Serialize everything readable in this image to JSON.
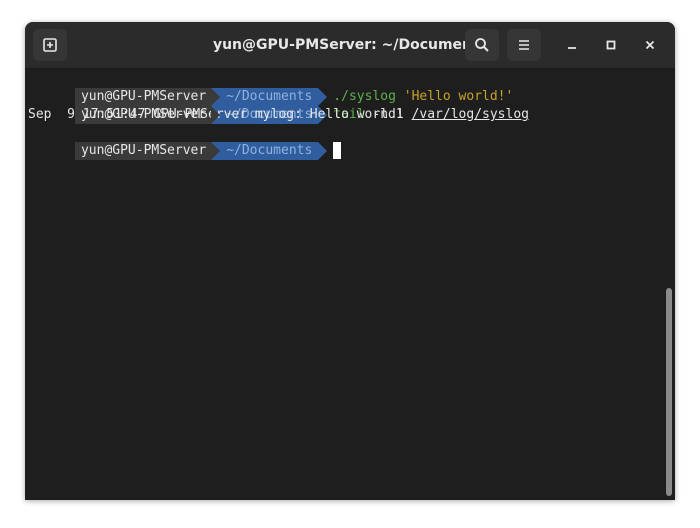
{
  "window": {
    "title": "yun@GPU-PMServer: ~/Documents"
  },
  "icons": {
    "new_tab": "new-tab-icon",
    "search": "search-icon",
    "menu": "hamburger-menu-icon",
    "minimize": "minimize-icon",
    "maximize": "maximize-icon",
    "close": "close-icon"
  },
  "colors": {
    "prompt_user_bg": "#3a3a3a",
    "prompt_dir_bg": "#2f5d9e",
    "command_green": "#5fb34a",
    "string_yellow": "#c9a227",
    "terminal_bg": "#1e1e1e"
  },
  "terminal": {
    "lines": [
      {
        "user": "yun@GPU-PMServer",
        "dir": "~/Documents",
        "command": "./syslog",
        "argument": "'Hello world!'"
      },
      {
        "user": "yun@GPU-PMServer",
        "dir": "~/Documents",
        "command": "tail",
        "options": "-n 1",
        "path": "/var/log/syslog"
      },
      {
        "output": "Sep  9 17:51:47 GPU-PMServer mylog: Hello world!"
      },
      {
        "user": "yun@GPU-PMServer",
        "dir": "~/Documents"
      }
    ]
  }
}
